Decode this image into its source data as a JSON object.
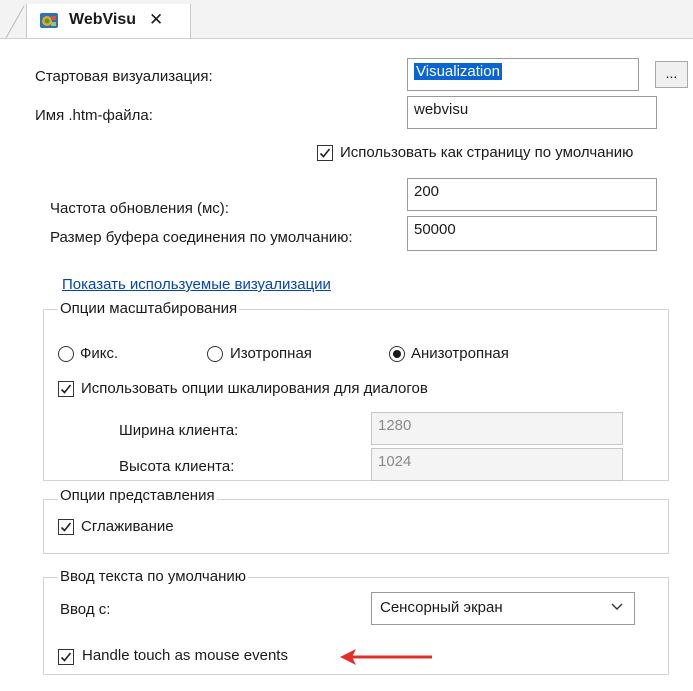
{
  "tab": {
    "title": "WebVisu",
    "close": "✕",
    "icon": "webvisu-icon"
  },
  "fields": {
    "start_visu_label": "Стартовая визуализация:",
    "start_visu_value": "Visualization",
    "browse_label": "...",
    "htm_label": "Имя .htm-файла:",
    "htm_value": "webvisu",
    "default_page_label": "Использовать как страницу по умолчанию",
    "default_page_checked": true,
    "update_rate_label": "Частота обновления (мс):",
    "update_rate_value": "200",
    "buffer_label": "Размер буфера соединения по умолчанию:",
    "buffer_value": "50000"
  },
  "link": {
    "show_used": "Показать используемые визуализации"
  },
  "scaling": {
    "title": "Опции масштабирования",
    "options": [
      "Фикс.",
      "Изотропная",
      "Анизотропная"
    ],
    "selected": "Анизотропная",
    "dialog_scaling_label": "Использовать опции шкалирования для диалогов",
    "dialog_scaling_checked": true,
    "client_width_label": "Ширина клиента:",
    "client_width_value": "1280",
    "client_height_label": "Высота клиента:",
    "client_height_value": "1024"
  },
  "presentation": {
    "title": "Опции представления",
    "antialias_label": "Сглаживание",
    "antialias_checked": true
  },
  "text_input": {
    "title": "Ввод текста по умолчанию",
    "input_label": "Ввод с:",
    "input_value": "Сенсорный экран",
    "touch_label": "Handle touch as mouse events",
    "touch_checked": true
  },
  "colors": {
    "accent": "#0a64d2",
    "link": "#0645ad",
    "arrow": "#e0302b"
  }
}
